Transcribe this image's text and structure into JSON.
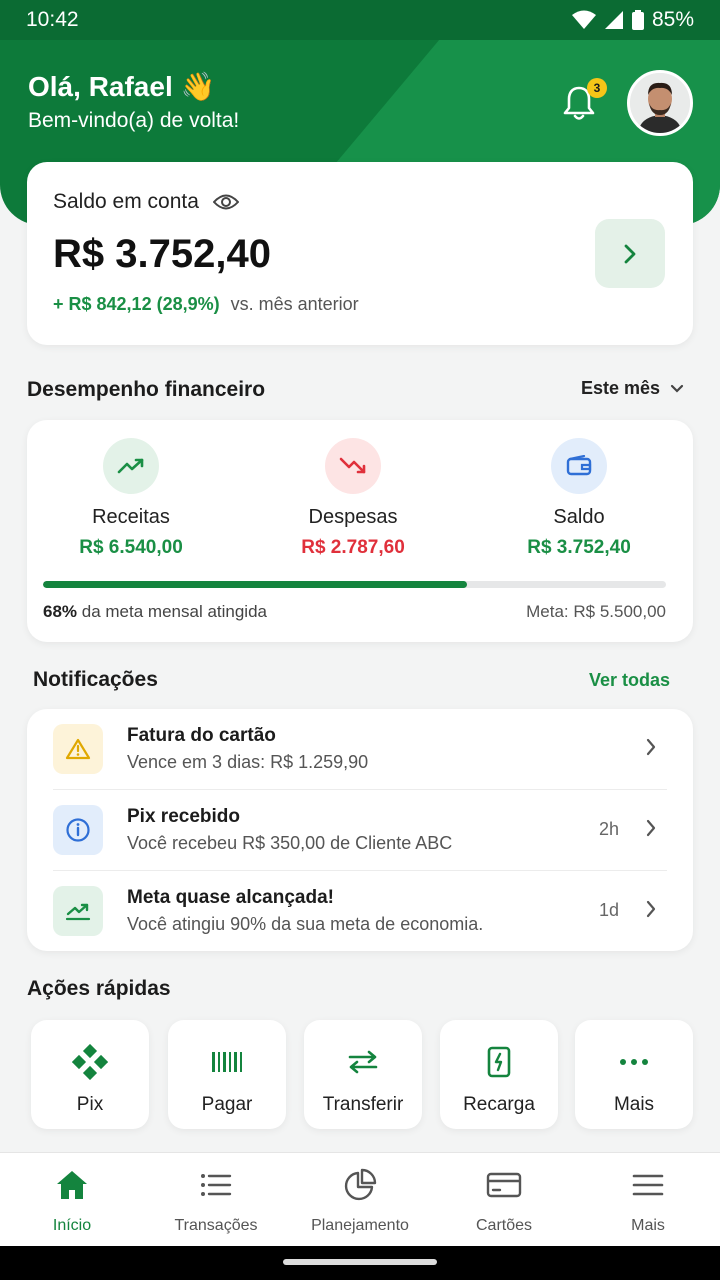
{
  "status_bar": {
    "time": "10:42",
    "battery": "85%"
  },
  "header": {
    "greeting": "Olá, Rafael",
    "greeting_emoji": "👋",
    "subtitle": "Bem-vindo(a) de volta!",
    "notification_count": "3"
  },
  "balance": {
    "label": "Saldo em conta",
    "amount": "R$ 3.752,40",
    "change": "+ R$ 842,12 (28,9%)",
    "comparison": "vs. mês anterior"
  },
  "performance": {
    "title": "Desempenho financeiro",
    "period": "Este mês",
    "items": [
      {
        "label": "Receitas",
        "value": "R$ 6.540,00",
        "color": "#1a8f45",
        "icon": "trending-up-icon"
      },
      {
        "label": "Despesas",
        "value": "R$ 2.787,60",
        "color": "#e0303b",
        "icon": "trending-down-icon"
      },
      {
        "label": "Saldo",
        "value": "R$ 3.752,40",
        "color": "#1a8f45",
        "icon": "wallet-icon"
      }
    ],
    "goal_progress": 0.68,
    "goal_percent": "68%",
    "goal_text": "da meta mensal atingida",
    "goal_target": "Meta: R$ 5.500,00"
  },
  "notifications": {
    "title": "Notificações",
    "see_all": "Ver todas",
    "items": [
      {
        "title": "Fatura do cartão",
        "description": "Vence em 3 dias: R$ 1.259,90",
        "time": "",
        "icon": "warning-icon"
      },
      {
        "title": "Pix recebido",
        "description": "Você recebeu R$ 350,00 de Cliente ABC",
        "time": "2h",
        "icon": "info-icon"
      },
      {
        "title": "Meta quase alcançada!",
        "description": "Você atingiu 90% da sua meta de economia.",
        "time": "1d",
        "icon": "chart-up-icon"
      }
    ]
  },
  "quick_actions": {
    "title": "Ações rápidas",
    "items": [
      {
        "label": "Pix",
        "icon": "pix-icon"
      },
      {
        "label": "Pagar",
        "icon": "barcode-icon"
      },
      {
        "label": "Transferir",
        "icon": "transfer-icon"
      },
      {
        "label": "Recarga",
        "icon": "phone-recharge-icon"
      },
      {
        "label": "Mais",
        "icon": "more-dots-icon"
      }
    ]
  },
  "bottom_nav": {
    "items": [
      {
        "label": "Início",
        "icon": "home-icon",
        "active": true
      },
      {
        "label": "Transações",
        "icon": "list-icon",
        "active": false
      },
      {
        "label": "Planejamento",
        "icon": "pie-chart-icon",
        "active": false
      },
      {
        "label": "Cartões",
        "icon": "card-icon",
        "active": false
      },
      {
        "label": "Mais",
        "icon": "menu-icon",
        "active": false
      }
    ]
  },
  "colors": {
    "brand": "#0d7a3a",
    "positive": "#1a8f45",
    "negative": "#e0303b"
  }
}
